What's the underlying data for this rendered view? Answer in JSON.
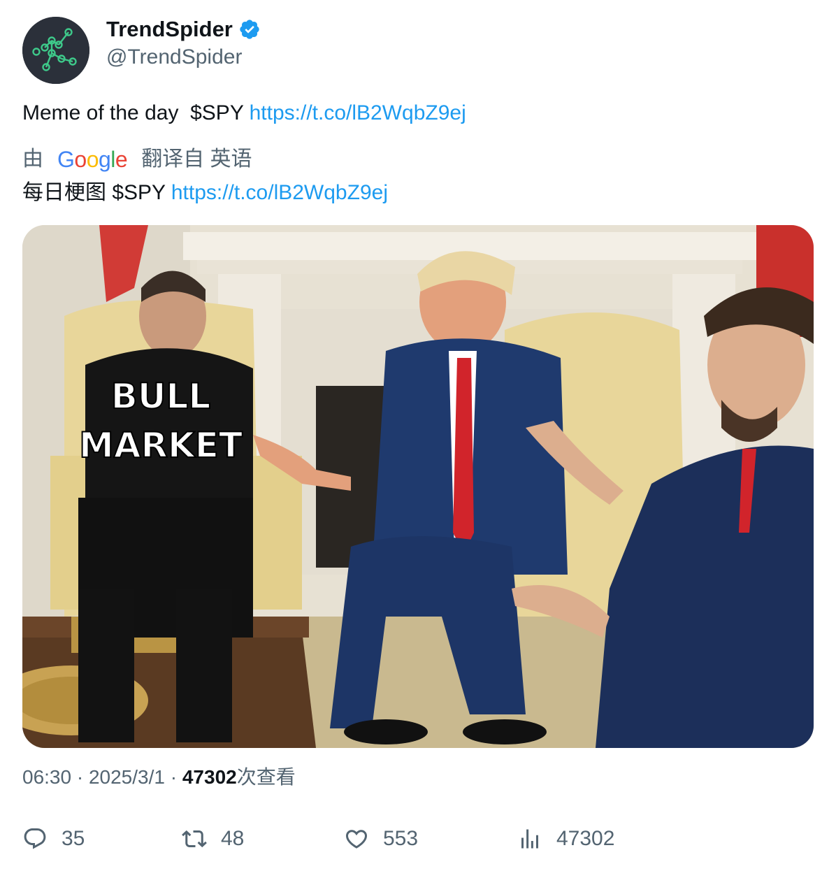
{
  "author": {
    "display_name": "TrendSpider",
    "handle": "@TrendSpider",
    "verified": true,
    "avatar_icon": "trendspider-logo-icon"
  },
  "tweet": {
    "text_prefix": "Meme of the day  $SPY ",
    "link": "https://t.co/lB2WqbZ9ej"
  },
  "translation": {
    "by_label": "由",
    "provider_logo": "Google",
    "from_label": "翻译自 英语",
    "text_prefix": "每日梗图 $SPY ",
    "link": "https://t.co/lB2WqbZ9ej"
  },
  "media": {
    "overlay_line1": "BULL",
    "overlay_line2": "MARKET"
  },
  "meta": {
    "time": "06:30",
    "separator": " · ",
    "date": "2025/3/1",
    "views_count": "47302",
    "views_label": "次查看"
  },
  "actions": {
    "replies": "35",
    "retweets": "48",
    "likes": "553",
    "views": "47302"
  },
  "colors": {
    "link": "#1d9bf0",
    "secondary_text": "#536471",
    "primary_text": "#0f1419",
    "verified": "#1d9bf0"
  }
}
